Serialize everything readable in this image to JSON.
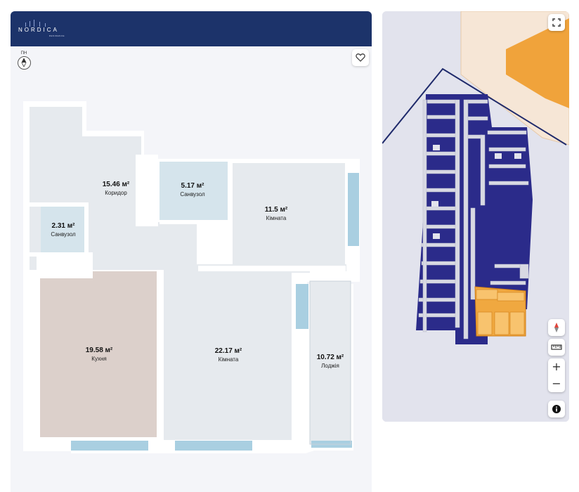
{
  "brand": {
    "name": "NORDICA",
    "subtitle": "RESIDENCE"
  },
  "compass": {
    "label": "ПН"
  },
  "rooms": [
    {
      "area": "15.46 м²",
      "name": "Коридор"
    },
    {
      "area": "5.17 м²",
      "name": "Санвузол"
    },
    {
      "area": "11.5 м²",
      "name": "Кімната"
    },
    {
      "area": "2.31 м²",
      "name": "Санвузол"
    },
    {
      "area": "19.58 м²",
      "name": "Кухня"
    },
    {
      "area": "22.17 м²",
      "name": "Кімната"
    },
    {
      "area": "10.72 м²",
      "name": "Лоджія"
    }
  ],
  "map_controls": {
    "fullscreen": "fullscreen-icon",
    "compass": "compass-icon",
    "ruler": "ruler-icon",
    "zoom_in": "+",
    "zoom_out": "−",
    "info": "info-icon"
  },
  "colors": {
    "header": "#1c336a",
    "kitchen": "#dcd0cb",
    "bathroom": "#d6e6ee",
    "floor": "#e7ebef",
    "window": "#a9cfe1",
    "building": "#2a2a8a",
    "highlight": "#f1a53a"
  }
}
